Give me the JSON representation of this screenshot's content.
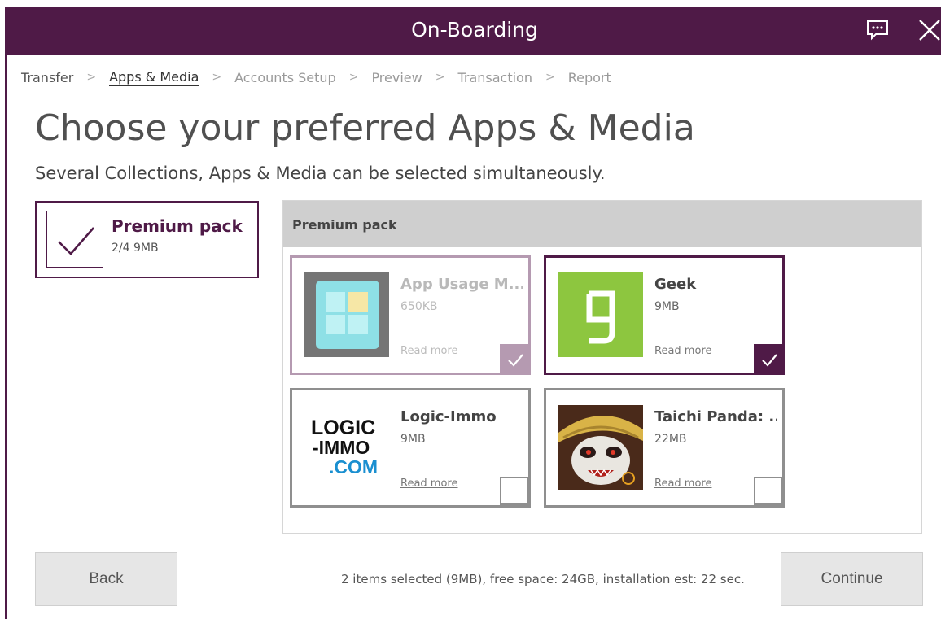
{
  "window": {
    "title": "On-Boarding"
  },
  "breadcrumb": [
    "Transfer",
    "Apps & Media",
    "Accounts Setup",
    "Preview",
    "Transaction",
    "Report"
  ],
  "page": {
    "heading": "Choose your preferred Apps & Media",
    "subheading": "Several Collections, Apps & Media can be selected simultaneously."
  },
  "collection": {
    "name": "Premium pack",
    "meta": "2/4 9MB",
    "checked": true
  },
  "panel": {
    "title": "Premium pack",
    "apps": [
      {
        "name": "App Usage M...",
        "size": "650KB",
        "link": "Read more",
        "state": "selected-disabled"
      },
      {
        "name": "Geek",
        "size": "9MB",
        "link": "Read more",
        "state": "selected"
      },
      {
        "name": "Logic-Immo",
        "size": "9MB",
        "link": "Read more",
        "state": "unselected",
        "logo_lines": [
          "LOGIC",
          "-IMMO",
          ".COM"
        ]
      },
      {
        "name": "Taichi Panda: ...",
        "size": "22MB",
        "link": "Read more",
        "state": "unselected"
      }
    ]
  },
  "footer": {
    "back_label": "Back",
    "status": "2 items selected (9MB), free space: 24GB, installation est: 22 sec.",
    "continue_label": "Continue"
  },
  "colors": {
    "accent": "#4f1a47",
    "disabled_accent": "#b59ab1",
    "geek_green": "#8dc63f",
    "logic_blue": "#1a8fd0"
  }
}
